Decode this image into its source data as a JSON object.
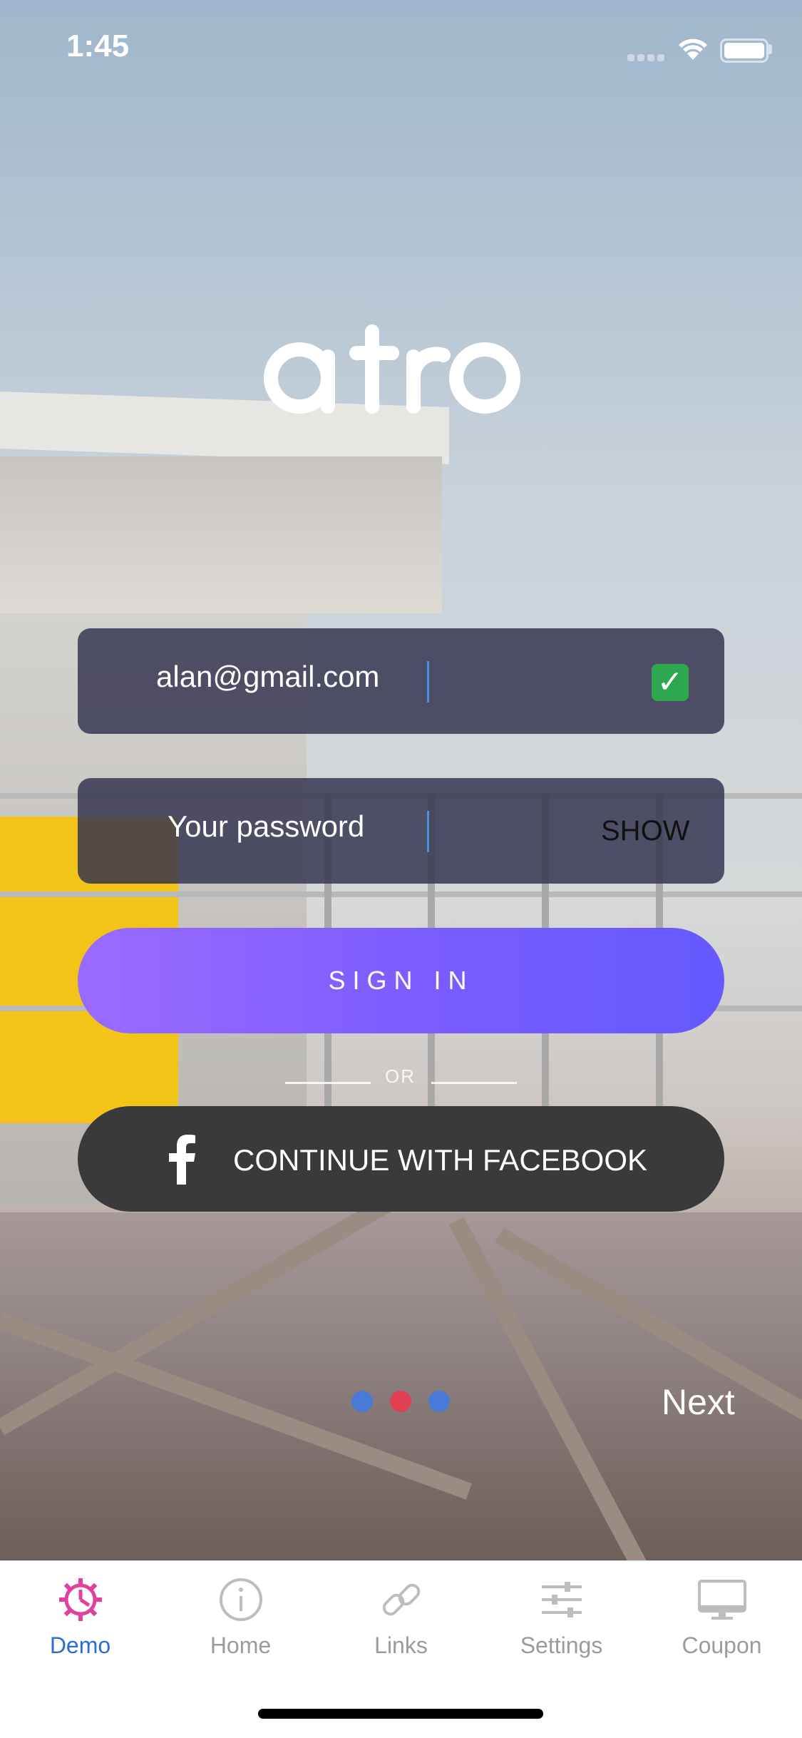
{
  "status_bar": {
    "time": "1:45"
  },
  "login": {
    "email_value": "alan@gmail.com",
    "password_placeholder": "Your password",
    "show_label": "SHOW",
    "sign_in_label": "SIGN IN",
    "or_label": "OR",
    "facebook_label": "CONTINUE WITH FACEBOOK",
    "next_label": "Next"
  },
  "pager": {
    "count": 3,
    "active_index": 1
  },
  "tabs": [
    {
      "label": "Demo",
      "icon": "gear-icon",
      "active": true
    },
    {
      "label": "Home",
      "icon": "info-icon",
      "active": false
    },
    {
      "label": "Links",
      "icon": "link-icon",
      "active": false
    },
    {
      "label": "Settings",
      "icon": "sliders-icon",
      "active": false
    },
    {
      "label": "Coupon",
      "icon": "monitor-icon",
      "active": false
    }
  ],
  "colors": {
    "accent": "#2a6fd8",
    "tab_active_icon": "#e0409e",
    "sign_in_gradient_start": "#9b6bff",
    "sign_in_gradient_end": "#645aff",
    "facebook_bg": "#3a3a3c",
    "input_bg": "#343450",
    "dot_blue": "#4a7ad8",
    "dot_red": "#e04152"
  }
}
